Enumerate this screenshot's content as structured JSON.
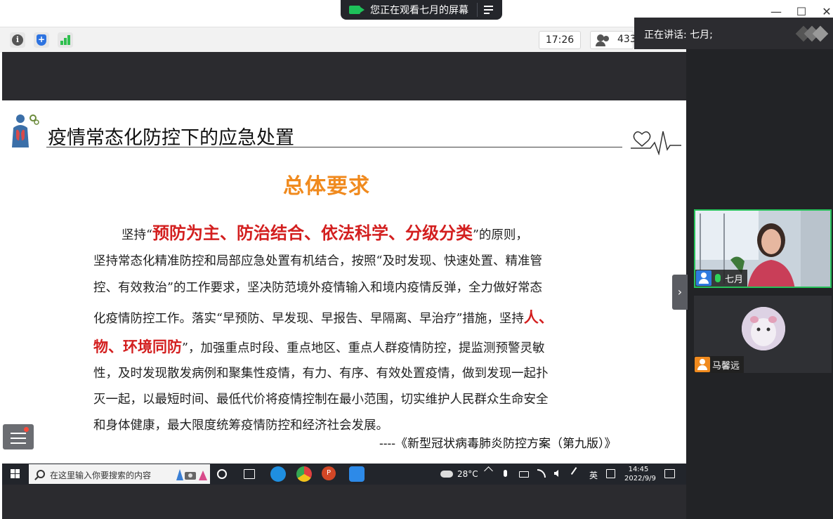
{
  "share_banner": {
    "text": "您正在观看七月的屏幕"
  },
  "window_controls": {
    "minimize": "—",
    "maximize": "☐",
    "close": "✕"
  },
  "toolbar": {
    "clock": "17:26",
    "participant_count": "433"
  },
  "speaking": {
    "label": "正在讲话: 七月;"
  },
  "slide": {
    "title": "疫情常态化防控下的应急处置",
    "heading": "总体要求",
    "p1_pre": "坚持“",
    "p1_red": "预防为主、防治结合、依法科学、分级分类",
    "p1_post": "”的原则，",
    "line2": "坚持常态化精准防控和局部应急处置有机结合，按照“及时发现、快速处置、精准管",
    "line3": "控、有效救治”的工作要求，坚决防范境外疫情输入和境内疫情反弹，全力做好常态",
    "line4_pre": "化疫情防控工作。落实“早预防、早发现、早报告、早隔离、早治疗”措施，坚持",
    "line4_red": "人、",
    "line5_red": "物、环境同防",
    "line5_post": "”，加强重点时段、重点地区、重点人群疫情防控，提监测预警灵敏",
    "line6": "性，及时发现散发病例和聚集性疫情，有力、有序、有效处置疫情，做到发现一起扑",
    "line7": "灭一起，以最短时间、最低代价将疫情控制在最小范围，切实维护人民群众生命安全",
    "line8": "和身体健康，最大限度统筹疫情防控和经济社会发展。",
    "source": "----《新型冠状病毒肺炎防控方案（第九版）》"
  },
  "taskbar": {
    "search_placeholder": "在这里输入你要搜索的内容",
    "temperature": "28°C",
    "ime": "英",
    "time": "14:45",
    "date": "2022/9/9"
  },
  "participants": [
    {
      "name": "七月",
      "avatar_color": "#2f7be0",
      "speaking": true
    },
    {
      "name": "马馨远",
      "avatar_color": "#f08a1e",
      "speaking": false
    }
  ],
  "colors": {
    "accent_orange": "#f08a1e",
    "emphasis_red": "#d31f1f",
    "active_border": "#27c25a"
  }
}
